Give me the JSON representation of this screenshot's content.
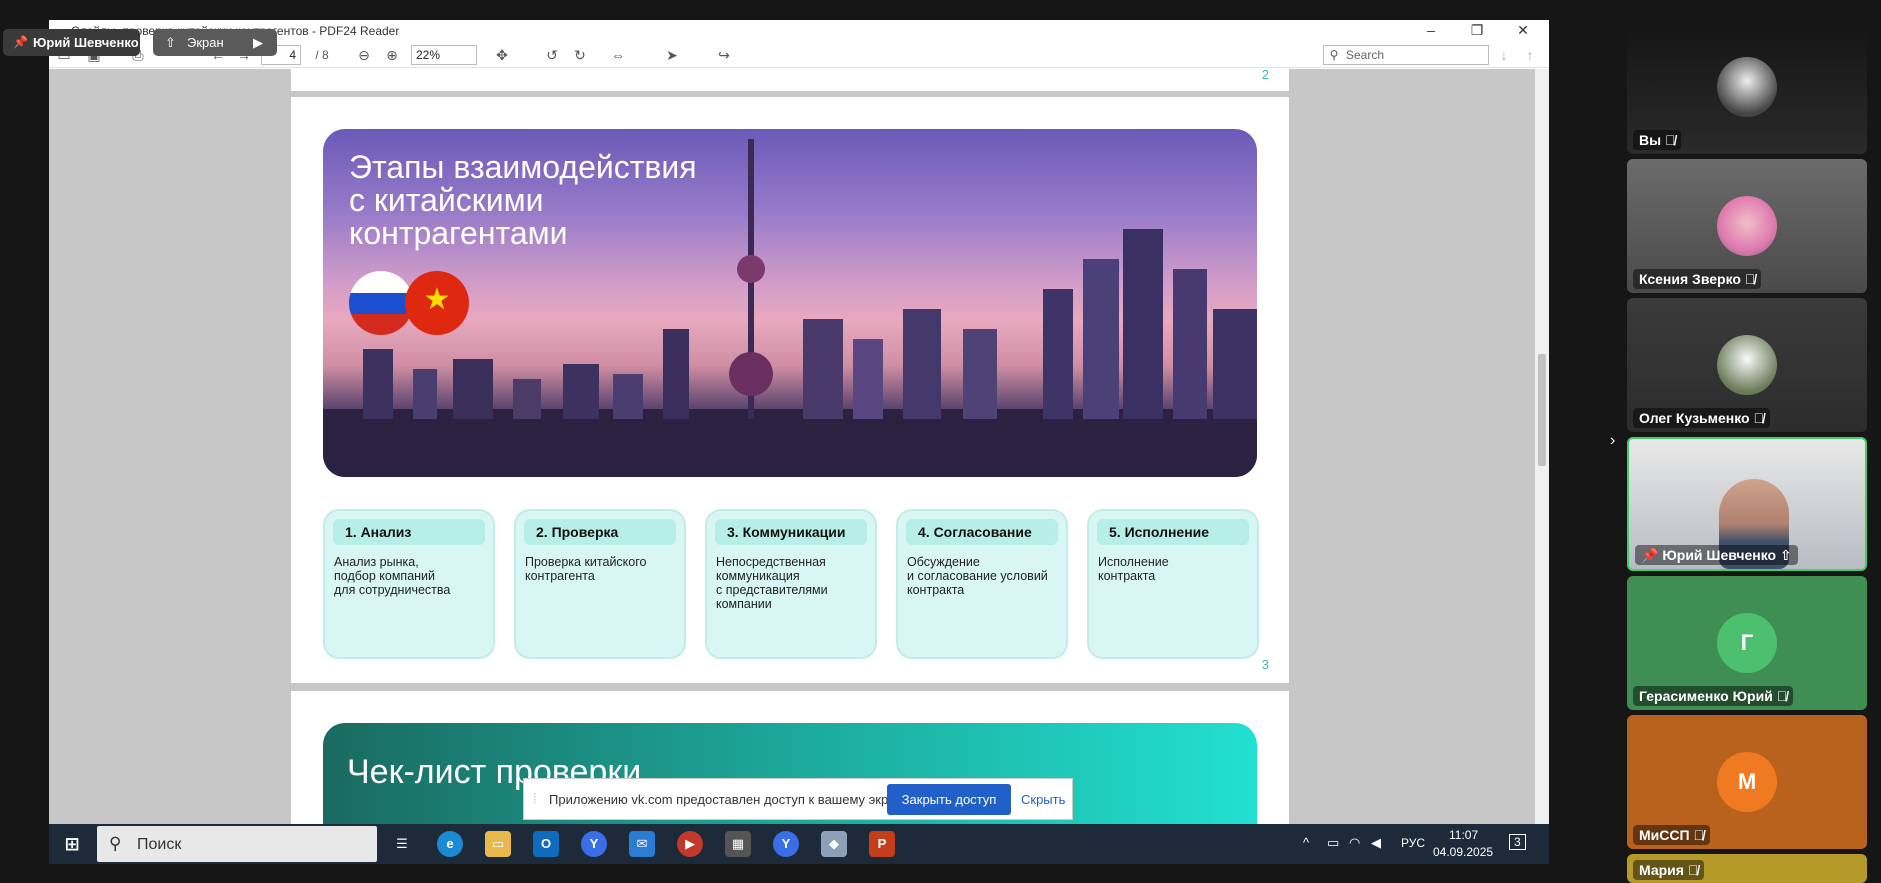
{
  "pdf": {
    "window_title": "Слайды_проверка китайских контрагентов - PDF24 Reader",
    "page_current": "4",
    "page_total": "/ 8",
    "zoom": "22%",
    "search_placeholder": "Search",
    "page2_number": "2",
    "page3_number": "3",
    "hero_title": "Этапы взаимодействия\nс китайскими\nконтрагентами",
    "steps": [
      {
        "title": "1. Анализ",
        "body": "Анализ рынка,\nподбор компаний\nдля сотрудничества"
      },
      {
        "title": "2. Проверка",
        "body": "Проверка китайского\nконтрагента"
      },
      {
        "title": "3. Коммуникации",
        "body": "Непосредственная\nкоммуникация\nс представителями\nкомпании"
      },
      {
        "title": "4. Согласование",
        "body": "Обсуждение\nи согласование условий\nконтракта"
      },
      {
        "title": "5. Исполнение",
        "body": "Исполнение\nконтракта"
      }
    ],
    "next_page_title": "Чек-лист проверки"
  },
  "notice": {
    "message": "Приложению vk.com предоставлен доступ к вашему экрану.",
    "close_label": "Закрыть доступ",
    "hide_label": "Скрыть"
  },
  "call": {
    "presenter_pill": "Юрий Шевченко",
    "screen_pill": "Экран",
    "participants": [
      {
        "name": "Вы",
        "kind": "video",
        "muted": true
      },
      {
        "name": "Ксения Зверко",
        "kind": "video",
        "muted": true
      },
      {
        "name": "Олег Кузьменко",
        "kind": "video",
        "muted": true
      },
      {
        "name": "Юрий Шевченко",
        "kind": "video",
        "muted": false
      },
      {
        "name": "Герасименко Юрий",
        "kind": "avatar",
        "initial": "Г",
        "muted": true
      },
      {
        "name": "МиССП",
        "kind": "avatar",
        "initial": "М",
        "muted": true
      },
      {
        "name": "Мария",
        "kind": "partial",
        "muted": true
      }
    ]
  },
  "taskbar": {
    "search_label": "Поиск",
    "language": "РУС",
    "time": "11:07",
    "date": "04.09.2025",
    "notifications": "3"
  },
  "colors": {
    "accent": "#2060c8",
    "step_bg": "#d8f7f4",
    "step_header": "#b8eee8",
    "active_border": "#3fd06b"
  }
}
